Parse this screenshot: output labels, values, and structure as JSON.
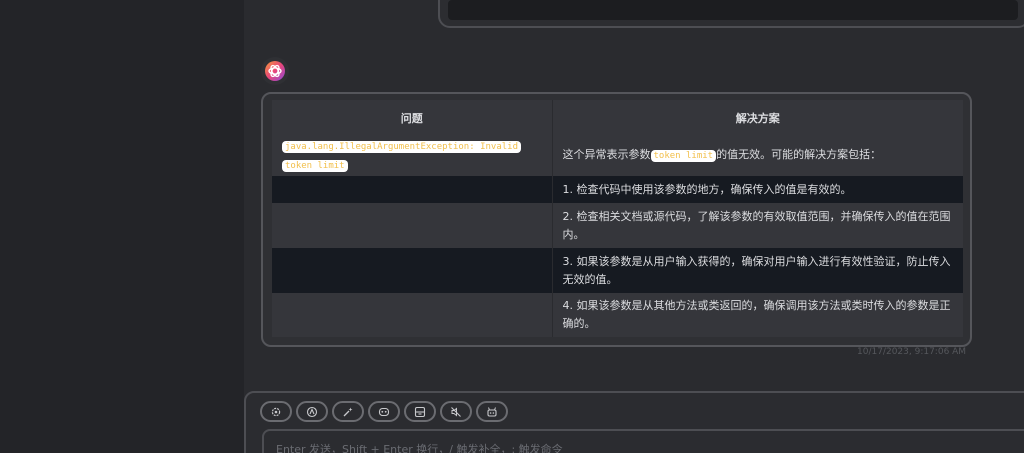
{
  "table": {
    "headers": [
      "问题",
      "解决方案"
    ],
    "rows": [
      {
        "issue_code": "java.lang.IllegalArgumentException: Invalid token limit",
        "solution_before": "这个异常表示参数",
        "solution_code": "token limit",
        "solution_after": "的值无效。可能的解决方案包括："
      },
      {
        "issue": "",
        "solution": "1. 检查代码中使用该参数的地方，确保传入的值是有效的。"
      },
      {
        "issue": "",
        "solution": "2. 检查相关文档或源代码，了解该参数的有效取值范围，并确保传入的值在范围内。"
      },
      {
        "issue": "",
        "solution": "3. 如果该参数是从用户输入获得的，确保对用户输入进行有效性验证，防止传入无效的值。"
      },
      {
        "issue": "",
        "solution": "4. 如果该参数是从其他方法或类返回的，确保调用该方法或类时传入的参数是正确的。"
      }
    ]
  },
  "message": {
    "timestamp": "10/17/2023, 9:17:06 AM"
  },
  "composer": {
    "placeholder": "Enter 发送，Shift + Enter 换行，/ 触发补全，: 触发命令",
    "tools": [
      "settings-icon",
      "theme-icon",
      "prompt-icon",
      "mask-icon",
      "context-icon",
      "mute-icon",
      "bot-icon"
    ]
  },
  "colors": {
    "accent": "#e8457a",
    "chip_text": "#f2c04d",
    "card_border": "#55565b"
  }
}
